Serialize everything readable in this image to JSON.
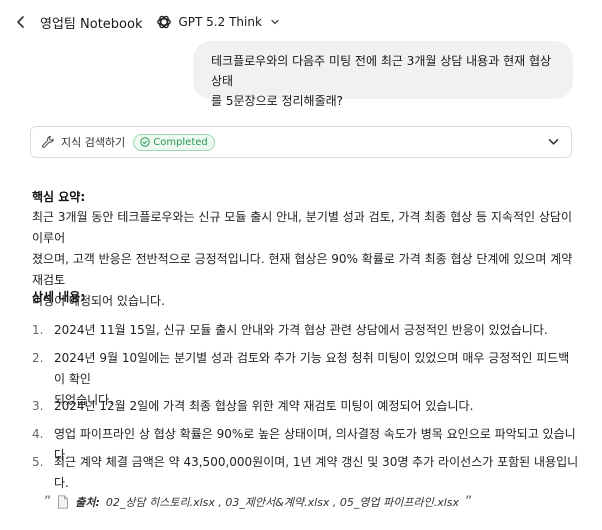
{
  "header": {
    "notebook_title": "영업팀 Notebook",
    "model_name": "GPT 5.2 Think"
  },
  "user_message": {
    "line1": "테크플로우와의 다음주 미팅 전에 최근 3개월 상담 내용과 현재 협상 상태",
    "line2": "를 5문장으로 정리해줄래?"
  },
  "knowledge_search": {
    "label": "지식 검색하기",
    "status": "Completed",
    "status_color": "#2b9a55"
  },
  "answer": {
    "summary_title": "핵심 요약:",
    "summary_lines": [
      "최근 3개월 동안 테크플로우와는 신규 모듈 출시 안내, 분기별 성과 검토, 가격 최종 협상 등 지속적인 상담이 이루어",
      "졌으며, 고객 반응은 전반적으로 긍정적입니다. 현재 협상은 90% 확률로 가격 최종 협상 단계에 있으며 계약 재검토",
      "미팅이 예정되어 있습니다."
    ],
    "detail_title": "상세 내용:",
    "items": [
      {
        "num": "1.",
        "lines": [
          "2024년 11월 15일, 신규 모듈 출시 안내와 가격 협상 관련 상담에서 긍정적인 반응이 있었습니다."
        ]
      },
      {
        "num": "2.",
        "lines": [
          "2024년 9월 10일에는 분기별 성과 검토와 추가 기능 요청 청취 미팅이 있었으며 매우 긍정적인 피드백이 확인",
          "되었습니다."
        ]
      },
      {
        "num": "3.",
        "lines": [
          "2024년 12월 2일에 가격 최종 협상을 위한 계약 재검토 미팅이 예정되어 있습니다."
        ]
      },
      {
        "num": "4.",
        "lines": [
          "영업 파이프라인 상 협상 확률은 90%로 높은 상태이며, 의사결정 속도가 병목 요인으로 파악되고 있습니다."
        ]
      },
      {
        "num": "5.",
        "lines": [
          "최근 계약 체결 금액은 약 43,500,000원이며, 1년 계약 갱신 및 30명 추가 라이선스가 포함된 내용입니다."
        ]
      }
    ],
    "source": {
      "open_quote": "”",
      "label": "출처:",
      "files": "02_상담 히스토리.xlsx , 03_제안서&계약.xlsx , 05_영업 파이프라인.xlsx",
      "close_quote": "”"
    }
  },
  "icons": [
    "back-chevron-icon",
    "openai-logo-icon",
    "chevron-down-icon",
    "wrench-icon",
    "check-circle-icon",
    "document-icon"
  ]
}
